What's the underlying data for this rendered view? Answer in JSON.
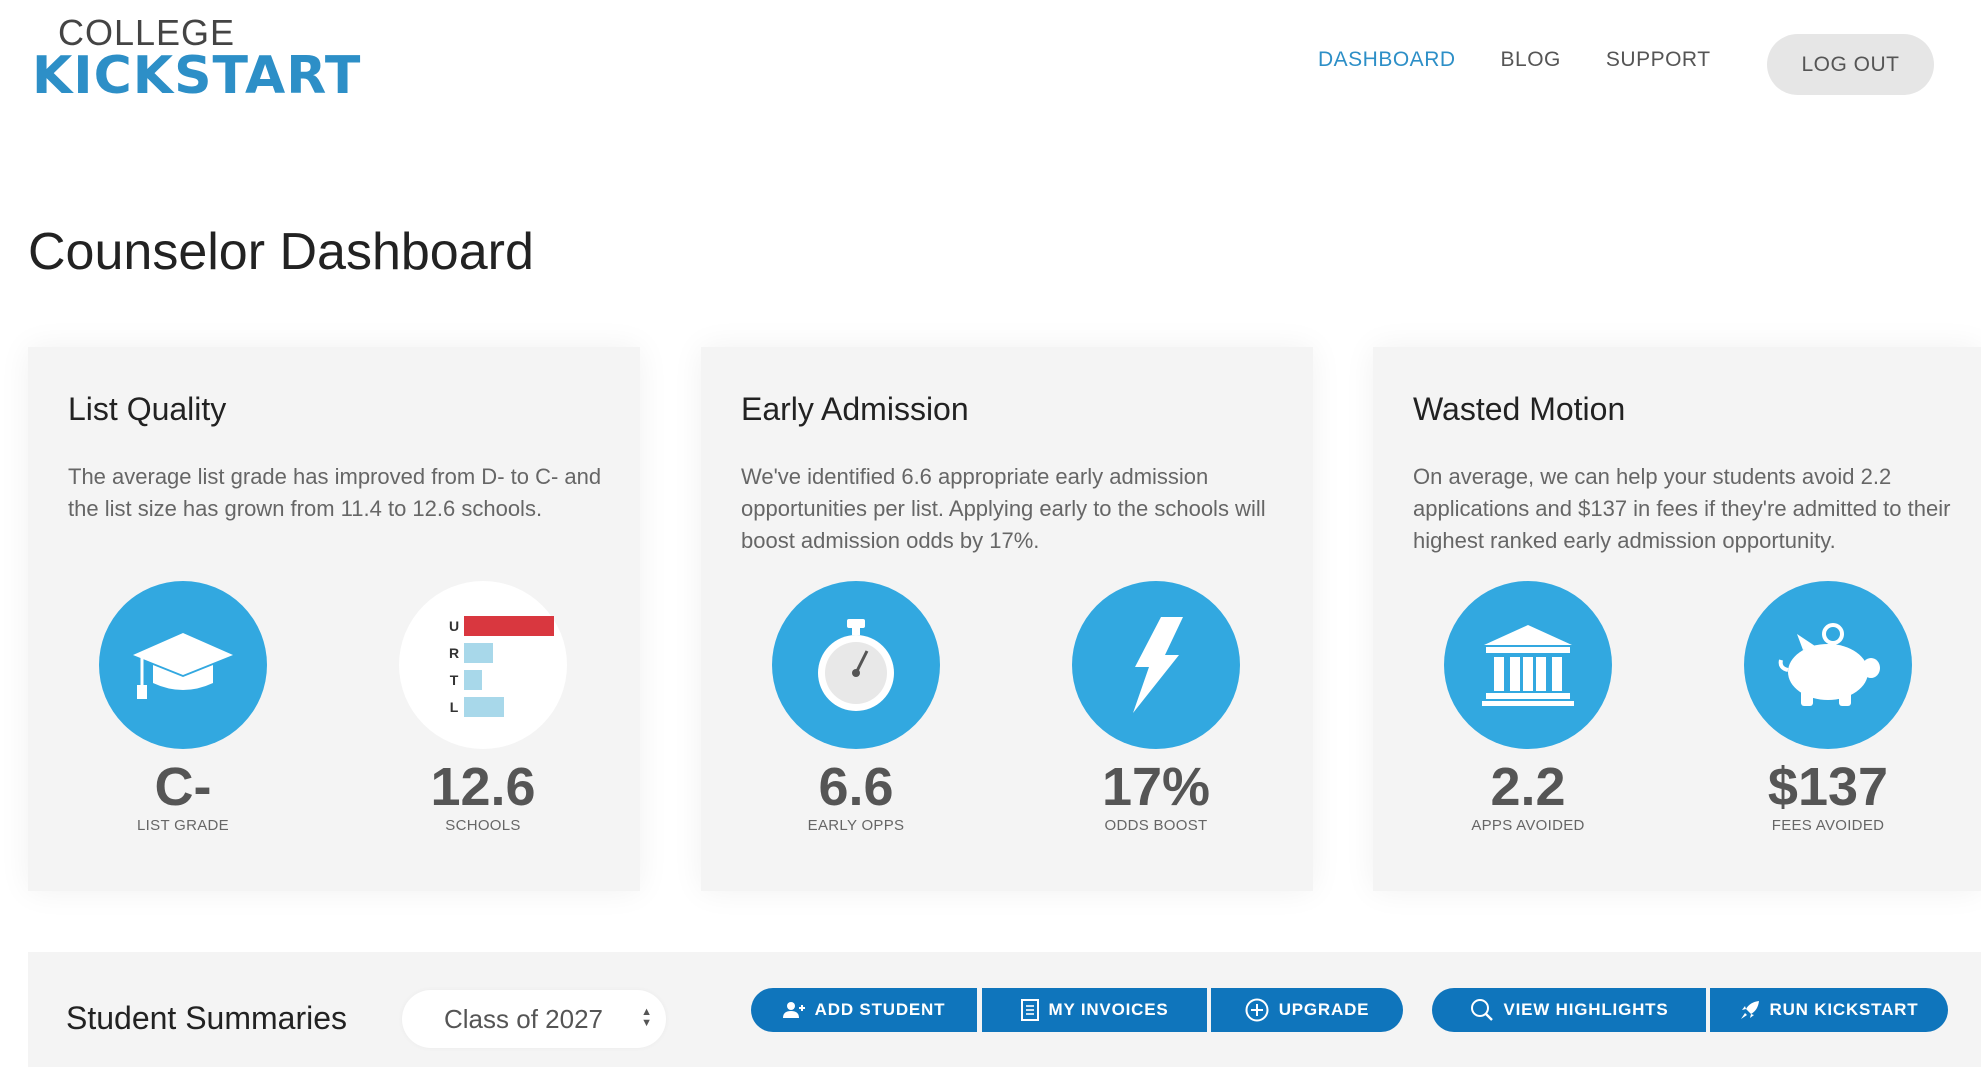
{
  "brand": {
    "line1": "COLLEGE",
    "line2": "KICKSTART",
    "color": "#2d8fc7"
  },
  "nav": {
    "items": [
      {
        "label": "DASHBOARD",
        "active": true
      },
      {
        "label": "BLOG",
        "active": false
      },
      {
        "label": "SUPPORT",
        "active": false
      }
    ],
    "logout_label": "LOG OUT"
  },
  "page": {
    "title": "Counselor Dashboard"
  },
  "cards": [
    {
      "title": "List Quality",
      "text": "The average list grade has improved from D- to C- and the list size has grown from 11.4 to 12.6 schools.",
      "metrics": [
        {
          "value": "C-",
          "label": "LIST GRADE",
          "icon": "graduation-cap-icon"
        },
        {
          "value": "12.6",
          "label": "SCHOOLS",
          "icon": "urtl-bar-chart-icon",
          "bars": [
            {
              "letter": "U",
              "level": 1.0,
              "color": "#d9373f"
            },
            {
              "letter": "R",
              "level": 0.32,
              "color": "#a8d8ea"
            },
            {
              "letter": "T",
              "level": 0.2,
              "color": "#a8d8ea"
            },
            {
              "letter": "L",
              "level": 0.44,
              "color": "#a8d8ea"
            }
          ]
        }
      ]
    },
    {
      "title": "Early Admission",
      "text": "We've identified 6.6 appropriate early admission opportunities per list. Applying early to the schools will boost admission odds by 17%.",
      "metrics": [
        {
          "value": "6.6",
          "label": "EARLY OPPS",
          "icon": "stopwatch-icon"
        },
        {
          "value": "17%",
          "label": "ODDS BOOST",
          "icon": "lightning-bolt-icon"
        }
      ]
    },
    {
      "title": "Wasted Motion",
      "text": "On average, we can help your students avoid 2.2 applications and $137 in fees if they're admitted to their highest ranked early admission opportunity.",
      "metrics": [
        {
          "value": "2.2",
          "label": "APPS AVOIDED",
          "icon": "bank-building-icon"
        },
        {
          "value": "$137",
          "label": "FEES AVOIDED",
          "icon": "piggy-bank-icon"
        }
      ]
    }
  ],
  "summaries": {
    "title": "Student Summaries",
    "class_select": {
      "value": "Class of 2027"
    },
    "buttons": {
      "add_student": "ADD STUDENT",
      "my_invoices": "MY INVOICES",
      "upgrade": "UPGRADE",
      "view_highlights": "VIEW HIGHLIGHTS",
      "run_kickstart": "RUN KICKSTART"
    }
  },
  "colors": {
    "accent": "#32a8e0",
    "button": "#0f75bc",
    "card_bg": "#f4f4f4"
  }
}
